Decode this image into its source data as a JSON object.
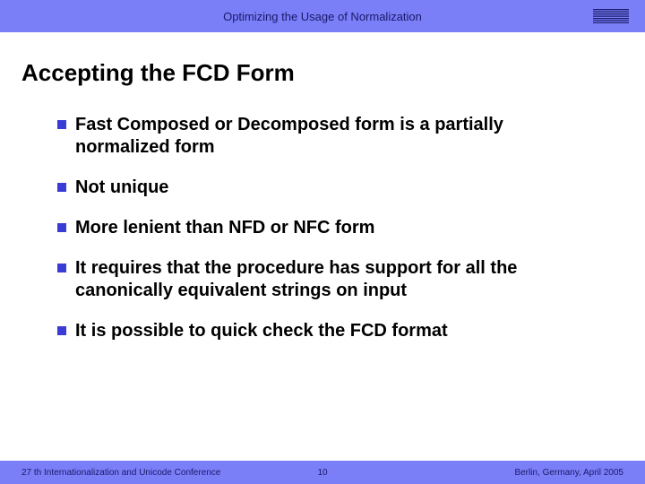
{
  "header": {
    "title": "Optimizing the Usage of Normalization",
    "logo_label": "IBM"
  },
  "slide": {
    "title": "Accepting the FCD Form",
    "bullets": [
      "Fast Composed or Decomposed form is a partially normalized form",
      "Not unique",
      "More lenient than NFD or NFC form",
      "It requires that the procedure has support for all the canonically equivalent strings on input",
      "It is possible to quick check the FCD format"
    ]
  },
  "footer": {
    "left": "27 th Internationalization and Unicode Conference",
    "center": "10",
    "right": "Berlin, Germany, April 2005"
  }
}
